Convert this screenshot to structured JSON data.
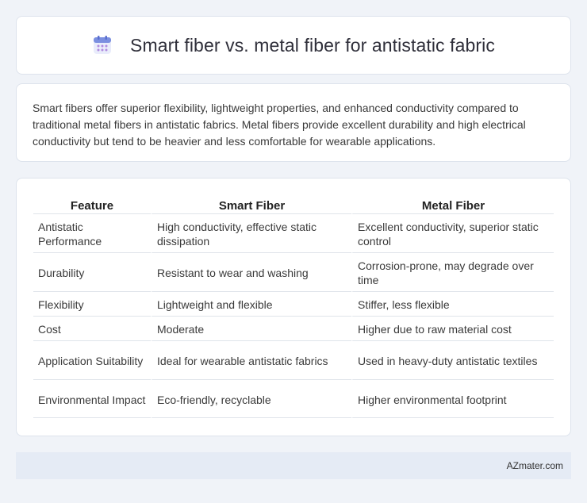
{
  "header": {
    "title": "Smart fiber vs. metal fiber for antistatic fabric",
    "icon": "calendar-icon",
    "icon_color": "#7b8fe0"
  },
  "description": "Smart fibers offer superior flexibility, lightweight properties, and enhanced conductivity compared to traditional metal fibers in antistatic fabrics. Metal fibers provide excellent durability and high electrical conductivity but tend to be heavier and less comfortable for wearable applications.",
  "table": {
    "headers": [
      "Feature",
      "Smart Fiber",
      "Metal Fiber"
    ],
    "rows": [
      [
        "Antistatic Performance",
        "High conductivity, effective static dissipation",
        "Excellent conductivity, superior static control"
      ],
      [
        "Durability",
        "Resistant to wear and washing",
        "Corrosion-prone, may degrade over time"
      ],
      [
        "Flexibility",
        "Lightweight and flexible",
        "Stiffer, less flexible"
      ],
      [
        "Cost",
        "Moderate",
        "Higher due to raw material cost"
      ],
      [
        "Application Suitability",
        "Ideal for wearable antistatic fabrics",
        "Used in heavy-duty antistatic textiles"
      ],
      [
        "Environmental Impact",
        "Eco-friendly, recyclable",
        "Higher environmental footprint"
      ]
    ]
  },
  "footer": {
    "brand": "AZmater.com"
  }
}
